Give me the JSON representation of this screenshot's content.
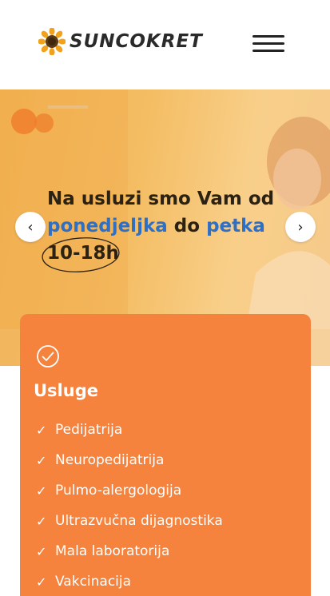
{
  "header": {
    "logo_text": "SUNCOKRET",
    "menu_icon": "hamburger-menu-icon"
  },
  "hero": {
    "line1": "Na usluzi smo Vam od",
    "from_day": "ponedjeljka",
    "connector": "do",
    "to_day": "petka",
    "hours": "10-18h",
    "prev_arrow": "‹",
    "next_arrow": "›",
    "accent_color": "#2f6fc4"
  },
  "services": {
    "title": "Usluge",
    "card_color": "#f5823d",
    "items": [
      "Pedijatrija",
      "Neuropedijatrija",
      "Pulmo-alergologija",
      "Ultrazvučna dijagnostika",
      "Mala laboratorija",
      "Vakcinacija"
    ]
  }
}
